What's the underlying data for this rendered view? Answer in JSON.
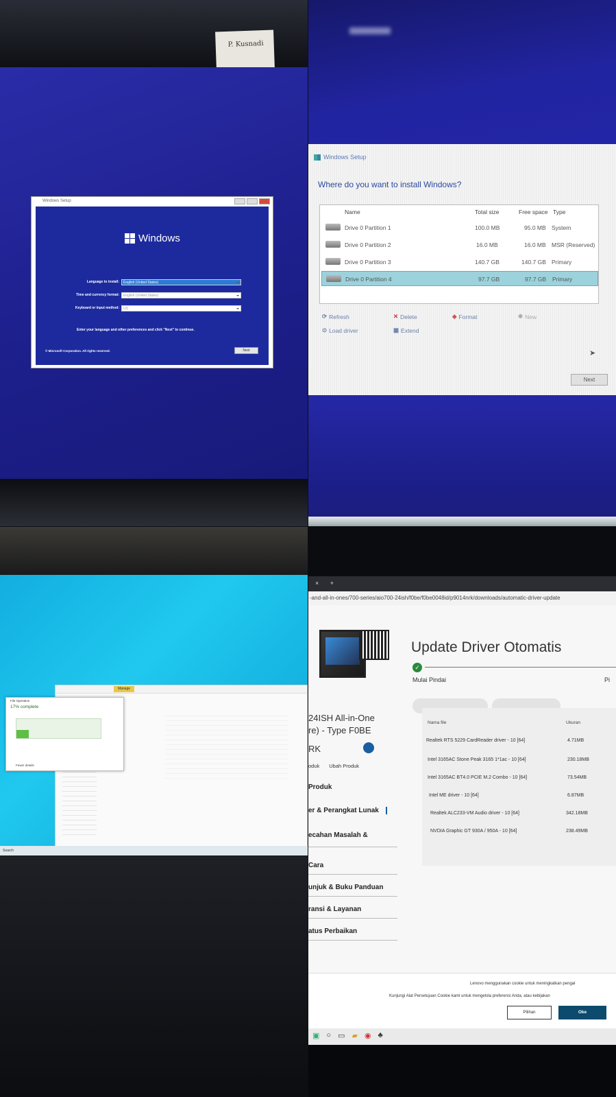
{
  "q1": {
    "note": "P. Kusnadi",
    "setup_title": "Windows Setup",
    "logo": "Windows",
    "lang_label": "Language to install:",
    "lang_value": "English (United States)",
    "time_label": "Time and currency format:",
    "time_value": "English (United States)",
    "kbd_label": "Keyboard or input method:",
    "kbd_value": "US",
    "hint": "Enter your language and other preferences and click \"Next\" to continue.",
    "copyright": "© Microsoft Corporation. All rights reserved.",
    "next": "Next"
  },
  "q2": {
    "title": "Windows Setup",
    "question": "Where do you want to install Windows?",
    "headers": {
      "name": "Name",
      "total": "Total size",
      "free": "Free space",
      "type": "Type"
    },
    "rows": [
      {
        "name": "Drive 0 Partition 1",
        "total": "100.0 MB",
        "free": "95.0 MB",
        "type": "System"
      },
      {
        "name": "Drive 0 Partition 2",
        "total": "16.0 MB",
        "free": "16.0 MB",
        "type": "MSR (Reserved)"
      },
      {
        "name": "Drive 0 Partition 3",
        "total": "140.7 GB",
        "free": "140.7 GB",
        "type": "Primary"
      },
      {
        "name": "Drive 0 Partition 4",
        "total": "97.7 GB",
        "free": "97.7 GB",
        "type": "Primary"
      }
    ],
    "refresh": "Refresh",
    "delete": "Delete",
    "format": "Format",
    "new": "New",
    "load_driver": "Load driver",
    "extend": "Extend",
    "next": "Next"
  },
  "q3": {
    "copy_title": "17% complete",
    "copy_header": "File Operation",
    "fewer": "Fewer details",
    "manage": "Manage",
    "search": "Search",
    "taskbar_search": "Search"
  },
  "q4": {
    "tab_close": "×",
    "tab_add": "+",
    "url": "-and-all-in-ones/700-series/aio700-24ish/f0be/f0be0048id/p9014nrk/downloads/automatic-driver-update",
    "headline": "Update Driver Otomatis",
    "check": "✓",
    "mulai": "Mulai Pindai",
    "pi": "Pi",
    "product_line1": "24ISH All-in-One",
    "product_line2": "re) - Type F0BE",
    "rk": "RK",
    "produk_short": "oduk",
    "ubah": "Ubah Produk",
    "nav": [
      "Produk",
      "er & Perangkat Lunak",
      "ecahan Masalah &",
      "Cara",
      "unjuk & Buku Panduan",
      "ransi & Layanan",
      "atus Perbaikan"
    ],
    "th_name": "Nama file",
    "th_size": "Ukuran",
    "drivers": [
      {
        "name": "Realtek RTS 5229 CardReader driver - 10 [64]",
        "size": "4.71MB"
      },
      {
        "name": "Intel 3165AC Stone Peak 3165 1*1ac - 10 [64]",
        "size": "230.18MB"
      },
      {
        "name": "Intel 3165AC BT4.0 PCIE M.2 Combo - 10 [64]",
        "size": "73.54MB"
      },
      {
        "name": "Intel ME driver - 10 [64]",
        "size": "6.87MB"
      },
      {
        "name": "Realtek ALC233-VM Audio driver - 10 [64]",
        "size": "342.18MB"
      },
      {
        "name": "NVDIA Graphic GT 930A / 950A - 10 [64]",
        "size": "238.49MB"
      }
    ],
    "cookie1": "Lenovo menggunakan cookie untuk meningkatkan pengal",
    "cookie2": "Kunjungi Alat Persetujuan Cookie kami untuk mengelola preferensi Anda, atau kebijakan",
    "pilihan": "Pilihan",
    "oke": "Oke"
  }
}
